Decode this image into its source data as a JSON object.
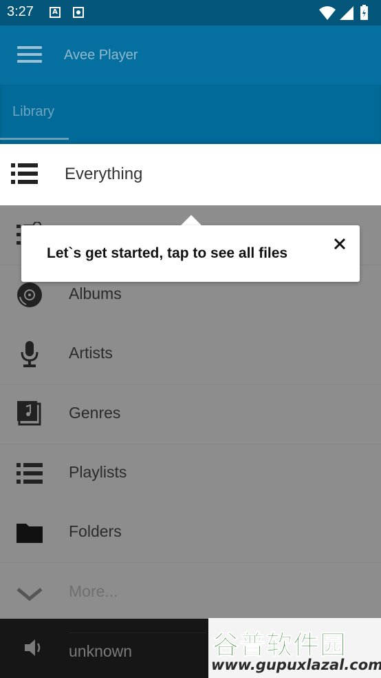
{
  "status_bar": {
    "time": "3:27",
    "notif_a": "A"
  },
  "app_bar": {
    "title": "Avee Player"
  },
  "tabs": [
    {
      "label": "Library"
    }
  ],
  "library": {
    "highlighted": {
      "label": "Everything",
      "icon": "list-icon"
    },
    "items": [
      {
        "label": "Albums",
        "icon": "disc-icon"
      },
      {
        "label": "Artists",
        "icon": "mic-icon"
      },
      {
        "label": "Genres",
        "icon": "music-note-icon"
      },
      {
        "label": "Playlists",
        "icon": "list-icon"
      },
      {
        "label": "Folders",
        "icon": "folder-icon"
      },
      {
        "label": "More...",
        "icon": "chevron-down-icon"
      }
    ]
  },
  "tooltip": {
    "message": "Let`s get started, tap to see all files"
  },
  "player": {
    "track": "unknown"
  },
  "watermark": {
    "chinese": "谷普软件园",
    "url": "www.gupuxlazal.com"
  },
  "colors": {
    "status_bar": "#03567a",
    "app_bar": "#056fa0",
    "overlay": "#8d8d8d",
    "player": "#161616"
  }
}
